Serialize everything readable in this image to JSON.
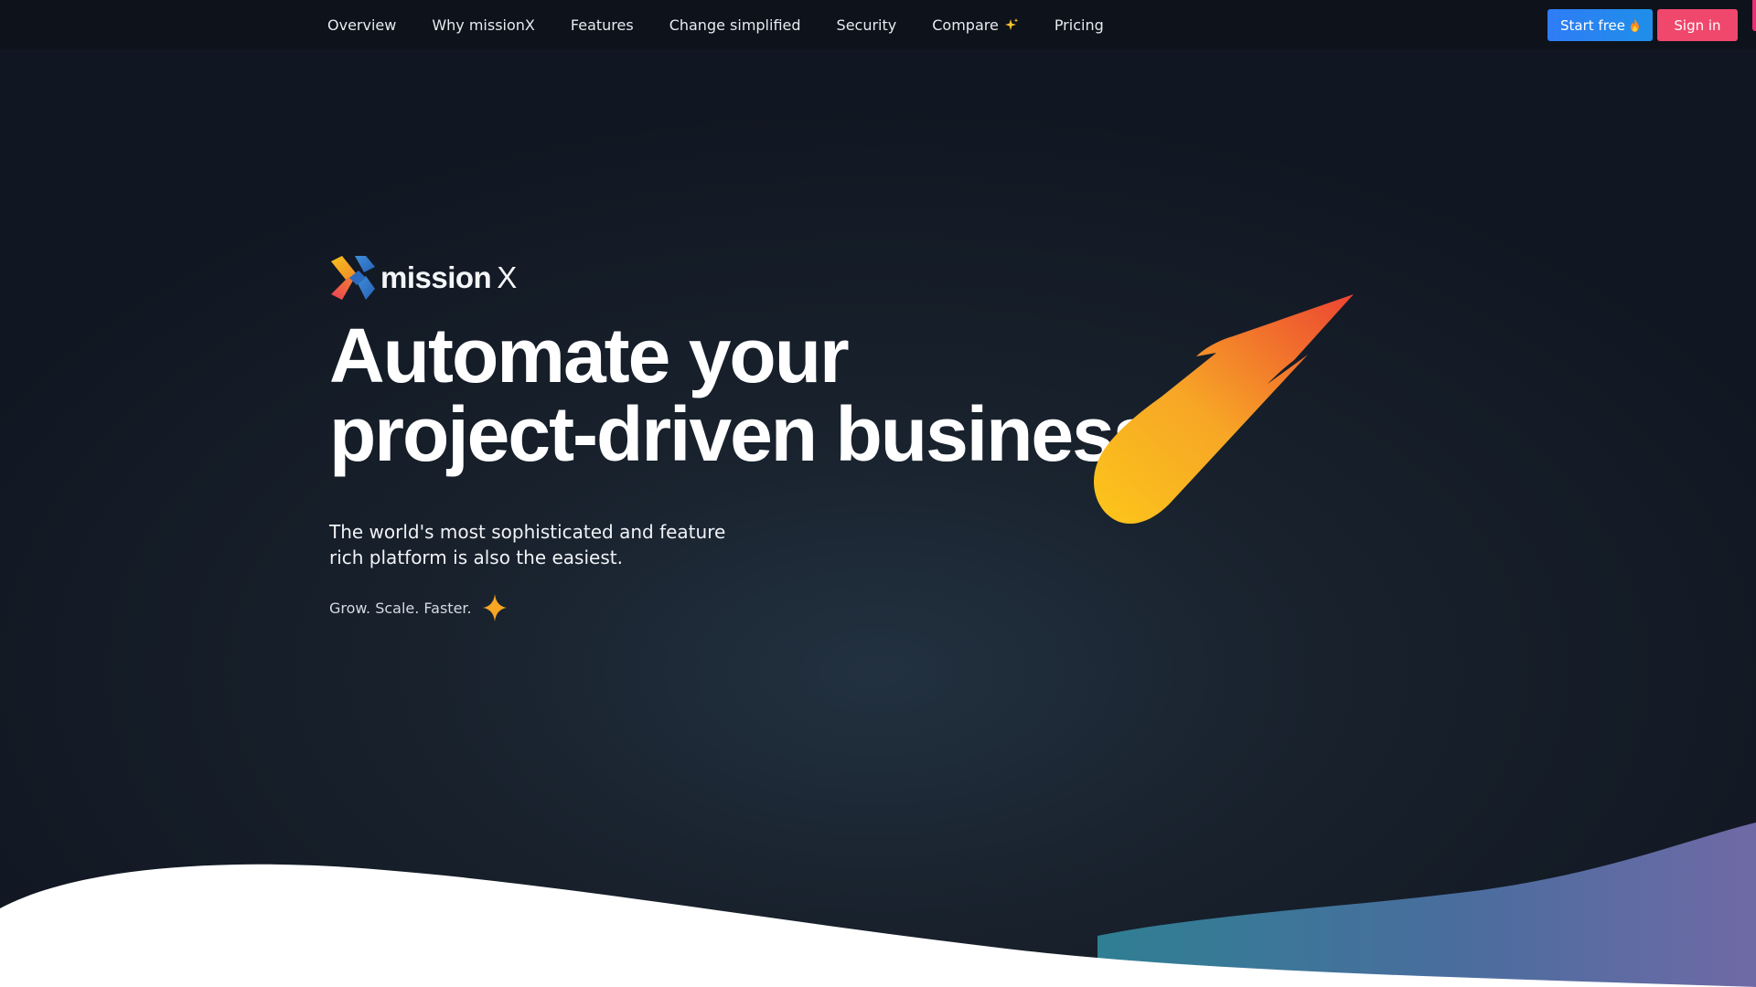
{
  "nav": {
    "items": [
      {
        "label": "Overview"
      },
      {
        "label": "Why missionX"
      },
      {
        "label": "Features"
      },
      {
        "label": "Change simplified"
      },
      {
        "label": "Security"
      },
      {
        "label": "Compare",
        "icon": "sparkle-icon"
      },
      {
        "label": "Pricing"
      }
    ],
    "start_label": "Start free",
    "start_icon": "flame-icon",
    "signin_label": "Sign in"
  },
  "brand": {
    "name": "mission",
    "name_suffix": "X",
    "logo_icon": "missionx-logo-icon"
  },
  "hero": {
    "headline_line1": "Automate your",
    "headline_line2": "project-driven business.",
    "subtitle_line1": "The world's most sophisticated and feature",
    "subtitle_line2": "rich platform is also the easiest.",
    "tagline": "Grow. Scale. Faster.",
    "tagline_icon": "sparkle-icon",
    "illustration_icon": "comet-icon"
  },
  "colors": {
    "background": "#18212c",
    "start_button": "#2f7cf6",
    "signin_button": "#f0476c",
    "comet_start": "#fcc61a",
    "comet_end": "#ec4533",
    "wave_teal": "#2f7f93",
    "wave_violet": "#6f6aa6"
  }
}
